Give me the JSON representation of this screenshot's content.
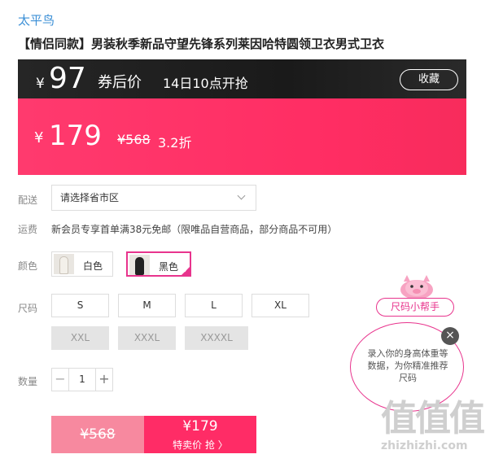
{
  "brand": "太平鸟",
  "product_title": "【情侣同款】男装秋季新品守望先锋系列莱因哈特圆领卫衣男式卫衣",
  "coupon_bar": {
    "currency": "¥",
    "price": "97",
    "after_coupon": "券后价",
    "start_time": "14日10点开抢",
    "favorite": "收藏"
  },
  "price_bar": {
    "currency": "¥",
    "price": "179",
    "original": "¥568",
    "discount": "3.2折"
  },
  "shipping": {
    "label": "配送",
    "placeholder": "请选择省市区"
  },
  "fee": {
    "label": "运费",
    "text": "新会员专享首单满38元免邮（限唯品自营商品，部分商品不可用）"
  },
  "color": {
    "label": "颜色",
    "options": [
      {
        "name": "白色",
        "selected": false
      },
      {
        "name": "黑色",
        "selected": true
      }
    ]
  },
  "size": {
    "label": "尺码",
    "options": [
      {
        "name": "S",
        "available": true
      },
      {
        "name": "M",
        "available": true
      },
      {
        "name": "L",
        "available": true
      },
      {
        "name": "XL",
        "available": true
      },
      {
        "name": "XXL",
        "available": false
      },
      {
        "name": "XXXL",
        "available": false
      },
      {
        "name": "XXXXL",
        "available": false
      }
    ]
  },
  "quantity": {
    "label": "数量",
    "value": "1",
    "minus": "−",
    "plus": "+"
  },
  "buy": {
    "original": "¥568",
    "price": "¥179",
    "action": "特卖价 抢 〉"
  },
  "size_helper": {
    "tag": "尺码小帮手",
    "bubble": "录入你的身高体重等数据，为你精准推荐尺码",
    "close": "×"
  },
  "watermark": {
    "big": "值值值",
    "small": "zhizhizhi.com"
  },
  "colors": {
    "accent": "#ff2c66",
    "helper": "#e8348d",
    "link": "#3b8fd6"
  }
}
